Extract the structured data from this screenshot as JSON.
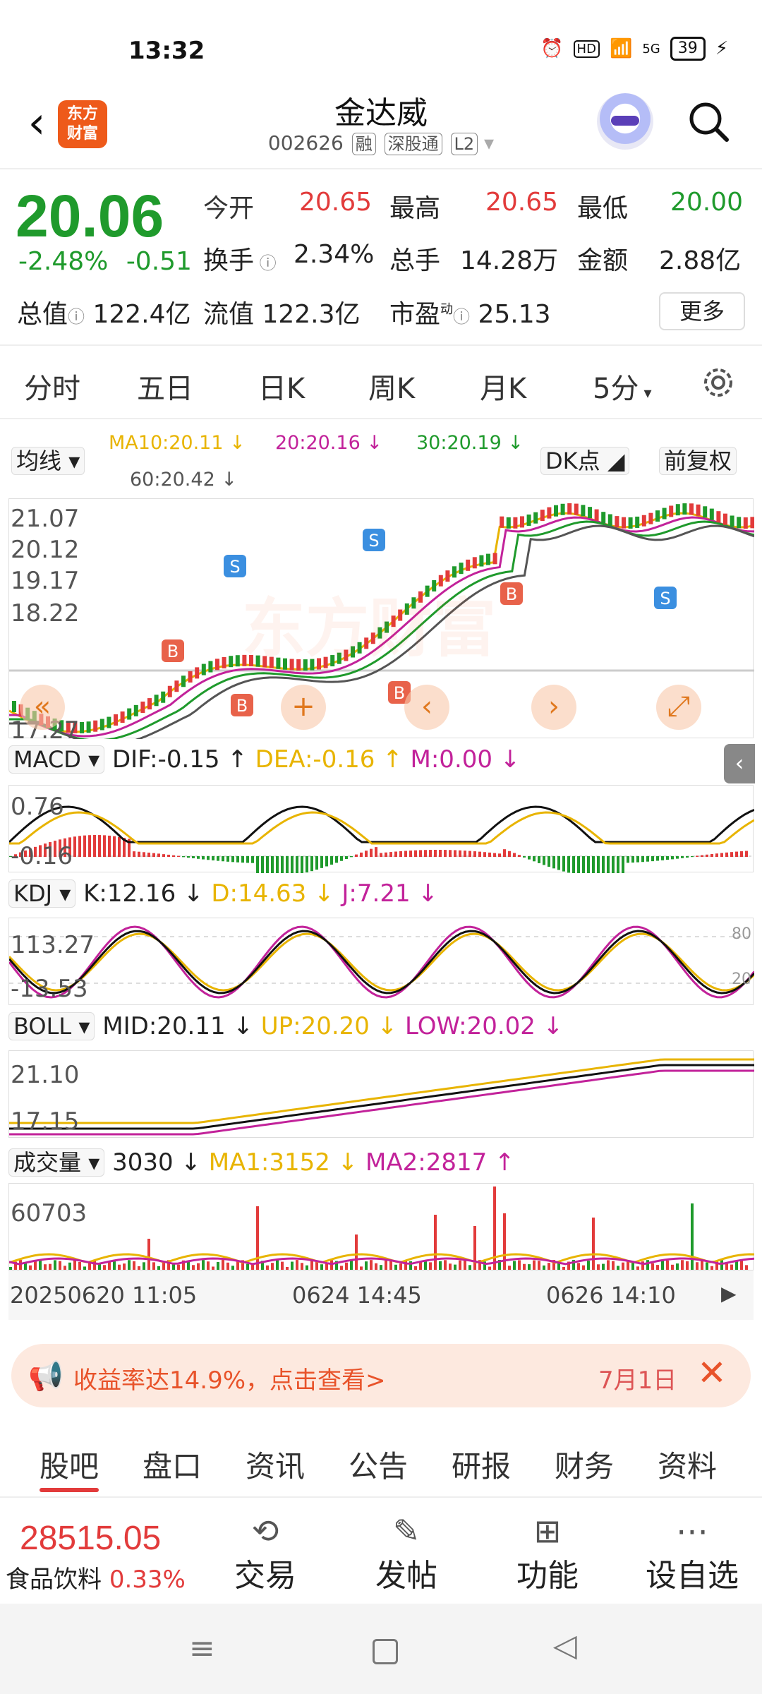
{
  "status": {
    "time": "13:32",
    "battery": "39",
    "net": "5G",
    "hd": "HD"
  },
  "header": {
    "back": "<",
    "logo_l1": "东方",
    "logo_l2": "财富",
    "title": "金达威",
    "code": "002626",
    "tags": [
      "融",
      "深股通",
      "L2"
    ]
  },
  "quote": {
    "price": "20.06",
    "change_pct": "-2.48%",
    "change": "-0.51",
    "open_label": "今开",
    "open": "20.65",
    "high_label": "最高",
    "high": "20.65",
    "low_label": "最低",
    "low": "20.00",
    "turnover_label": "换手",
    "turnover": "2.34%",
    "volume_label": "总手",
    "volume": "14.28万",
    "amount_label": "金额",
    "amount": "2.88亿",
    "mcap_label": "总值",
    "mcap": "122.4亿",
    "float_label": "流值",
    "float": "122.3亿",
    "pe_label": "市盈",
    "pe_sup": "动",
    "pe": "25.13",
    "more": "更多"
  },
  "periods": [
    "分时",
    "五日",
    "日K",
    "周K",
    "月K",
    "5分"
  ],
  "active_period": "5分",
  "chart": {
    "ma_select": "均线",
    "ma10": "MA10:20.11",
    "ma20": "20:20.16",
    "ma30": "30:20.19",
    "ma60": "60:20.42",
    "dk": "DK点",
    "fq": "前复权",
    "price_axis": [
      "21.07",
      "20.12",
      "19.17",
      "18.22",
      "17.27"
    ],
    "macd": {
      "label": "MACD",
      "dif": "DIF:-0.15",
      "dea": "DEA:-0.16",
      "m": "M:0.00",
      "axis": [
        "0.76",
        "-0.16"
      ]
    },
    "kdj": {
      "label": "KDJ",
      "k": "K:12.16",
      "d": "D:14.63",
      "j": "J:7.21",
      "axis": [
        "113.27",
        "-13.53"
      ],
      "lines": [
        "80",
        "20"
      ]
    },
    "boll": {
      "label": "BOLL",
      "mid": "MID:20.11",
      "up": "UP:20.20",
      "low": "LOW:20.02",
      "axis": [
        "21.10",
        "17.15"
      ]
    },
    "vol": {
      "label": "成交量",
      "v": "3030",
      "ma1": "MA1:3152",
      "ma2": "MA2:2817",
      "axis": [
        "60703"
      ]
    },
    "x_axis": [
      "20250620 11:05",
      "0624 14:45",
      "0626 14:10"
    ],
    "watermark": "东方财富"
  },
  "ad": {
    "text": "收益率达14.9%，点击查看>",
    "date": "7月1日"
  },
  "bottom_tabs": [
    "股吧",
    "盘口",
    "资讯",
    "公告",
    "研报",
    "财务",
    "资料"
  ],
  "active_bottom_tab": "股吧",
  "index": {
    "value": "28515.05",
    "name": "食品饮料",
    "pct": "0.33%"
  },
  "actions": [
    {
      "label": "交易",
      "icon": "trade-icon"
    },
    {
      "label": "发帖",
      "icon": "post-icon"
    },
    {
      "label": "功能",
      "icon": "grid-icon"
    },
    {
      "label": "设自选",
      "icon": "more-icon"
    }
  ],
  "colors": {
    "up": "#e23b3b",
    "down": "#1f9a2c",
    "accent": "#e0781e",
    "ma10": "#e8b400",
    "ma20": "#c2229a",
    "ma30": "#1f9a2c",
    "ma60": "#555555"
  }
}
